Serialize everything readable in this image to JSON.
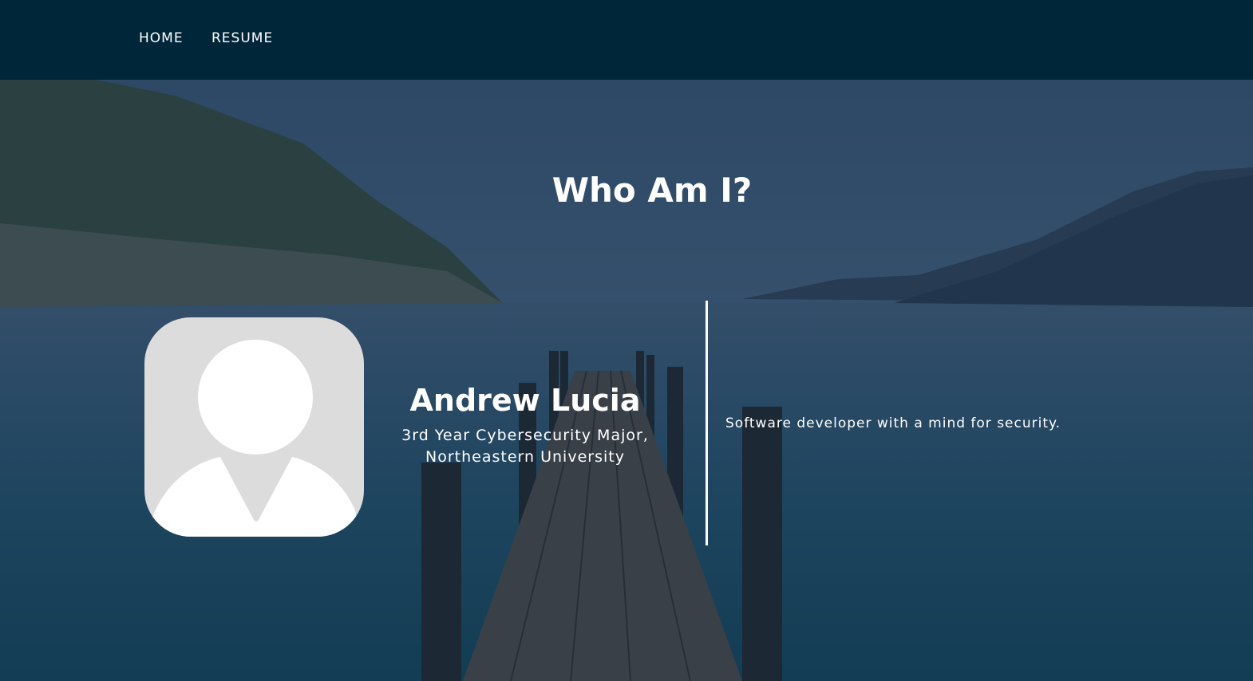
{
  "nav": {
    "items": [
      {
        "label": "HOME"
      },
      {
        "label": "RESUME"
      }
    ]
  },
  "hero": {
    "title": "Who Am I?"
  },
  "profile": {
    "name": "Andrew Lucia",
    "subtitle_line1": "3rd Year Cybersecurity Major,",
    "subtitle_line2": "Northeastern University",
    "tagline": "Software developer with a mind for security."
  },
  "colors": {
    "navbar_bg": "#00263a",
    "overlay": "#12263e",
    "text": "#ffffff",
    "avatar_bg": "#dcdcdc"
  }
}
